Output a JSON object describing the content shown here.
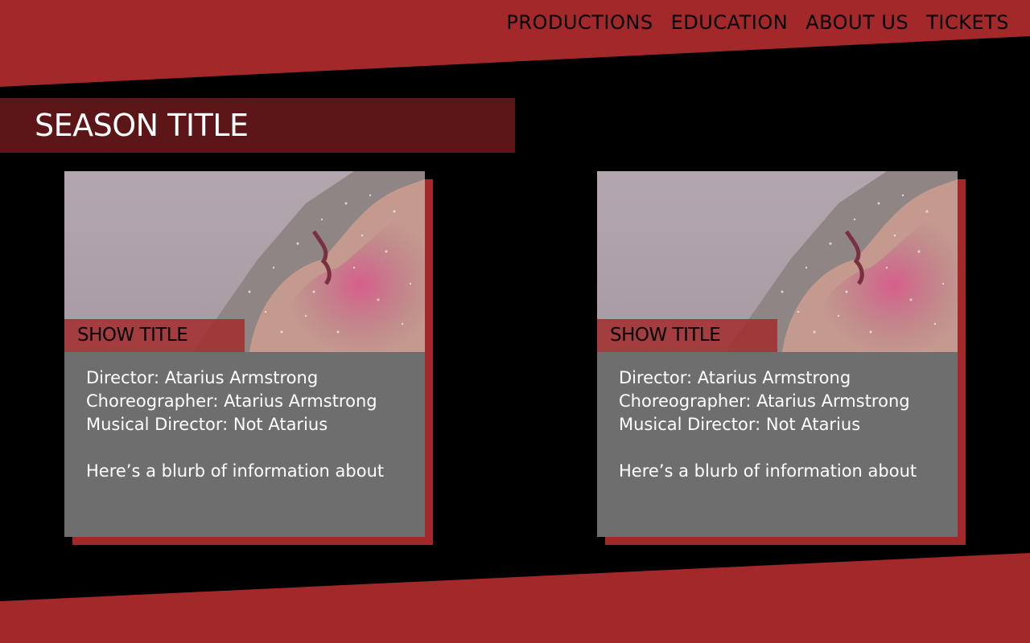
{
  "nav": {
    "items": [
      "PRODUCTIONS",
      "EDUCATION",
      "ABOUT US",
      "TICKETS"
    ]
  },
  "season": {
    "title": "SEASON TITLE"
  },
  "cards": [
    {
      "show_title": "SHOW TITLE",
      "director": "Director: Atarius Armstrong",
      "choreographer": "Choreographer: Atarius Armstrong",
      "musical_director": "Musical Director: Not Atarius",
      "blurb": "Here’s a blurb of information about"
    },
    {
      "show_title": "SHOW TITLE",
      "director": "Director: Atarius Armstrong",
      "choreographer": "Choreographer: Atarius Armstrong",
      "musical_director": "Musical Director: Not Atarius",
      "blurb": "Here’s a blurb of information about"
    }
  ],
  "colors": {
    "accent_red": "#a2282a",
    "dark_red": "#5c1617",
    "card_gray": "#6e6e6e",
    "background": "#000000"
  }
}
